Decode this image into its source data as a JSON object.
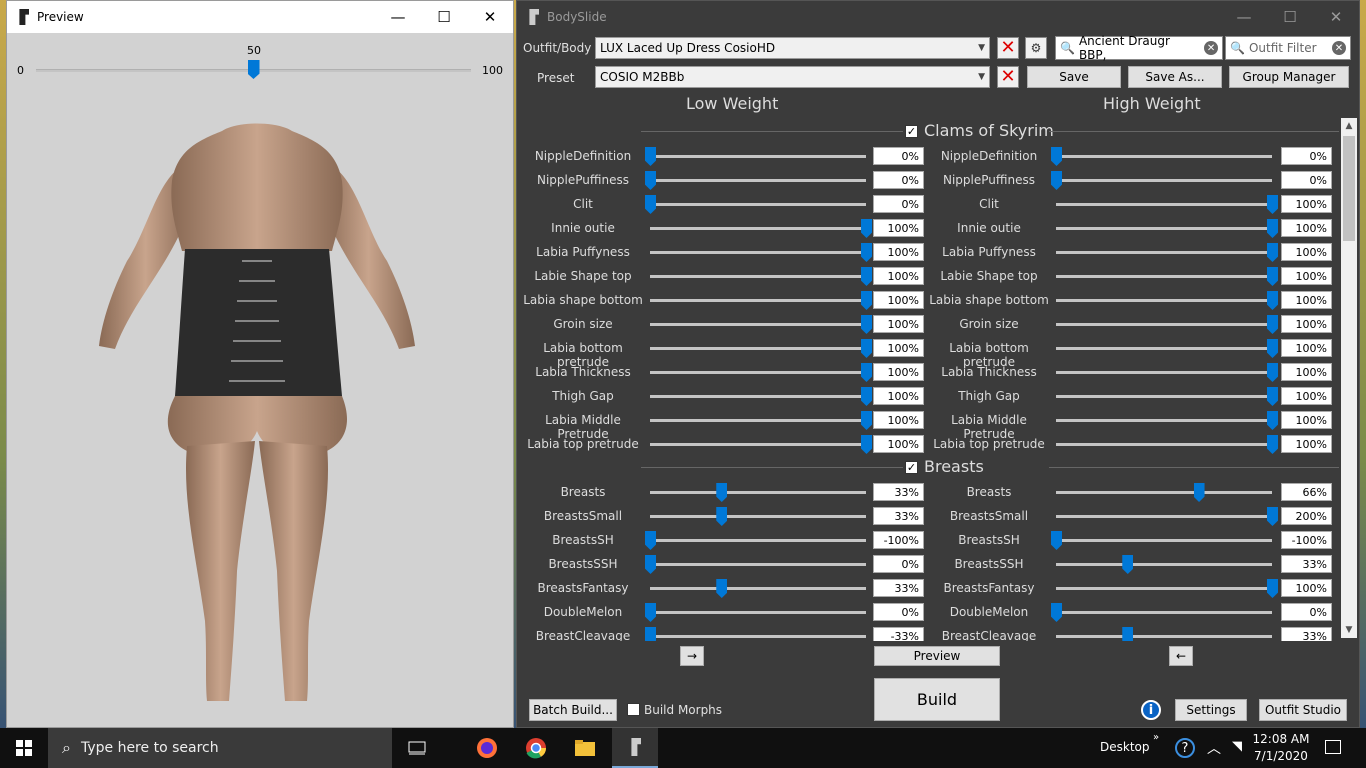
{
  "preview": {
    "title": "Preview",
    "slider_min": "0",
    "slider_max": "100",
    "slider_value": "50",
    "slider_level": 0.5
  },
  "bodyslide": {
    "title": "BodySlide",
    "outfit_label": "Outfit/Body",
    "outfit_value": "LUX Laced Up Dress CosioHD",
    "preset_label": "Preset",
    "preset_value": "COSIO M2BBb",
    "group_filter_value": "Ancient Draugr BBP,",
    "outfit_filter_placeholder": "Outfit Filter",
    "save_label": "Save",
    "save_as_label": "Save As...",
    "group_manager_label": "Group Manager",
    "low_weight_label": "Low Weight",
    "high_weight_label": "High Weight",
    "arrow_right": "→",
    "arrow_left": "←",
    "preview_label": "Preview",
    "build_label": "Build",
    "batch_build_label": "Batch Build...",
    "build_morphs_label": "Build Morphs",
    "settings_label": "Settings",
    "outfit_studio_label": "Outfit Studio",
    "groups": [
      {
        "name": "Clams of Skyrim",
        "sliders": [
          {
            "name": "NippleDefinition",
            "low": "0%",
            "high": "0%",
            "lowv": 0,
            "highv": 0
          },
          {
            "name": "NipplePuffiness",
            "low": "0%",
            "high": "0%",
            "lowv": 0,
            "highv": 0
          },
          {
            "name": "Clit",
            "low": "0%",
            "high": "100%",
            "lowv": 0,
            "highv": 100
          },
          {
            "name": "Innie outie",
            "low": "100%",
            "high": "100%",
            "lowv": 100,
            "highv": 100
          },
          {
            "name": "Labia Puffyness",
            "low": "100%",
            "high": "100%",
            "lowv": 100,
            "highv": 100
          },
          {
            "name": "Labie Shape top",
            "low": "100%",
            "high": "100%",
            "lowv": 100,
            "highv": 100
          },
          {
            "name": "Labia shape bottom",
            "low": "100%",
            "high": "100%",
            "lowv": 100,
            "highv": 100
          },
          {
            "name": "Groin size",
            "low": "100%",
            "high": "100%",
            "lowv": 100,
            "highv": 100
          },
          {
            "name": "Labia bottom pretrude",
            "low": "100%",
            "high": "100%",
            "lowv": 100,
            "highv": 100
          },
          {
            "name": "Labia Thickness",
            "low": "100%",
            "high": "100%",
            "lowv": 100,
            "highv": 100
          },
          {
            "name": "Thigh Gap",
            "low": "100%",
            "high": "100%",
            "lowv": 100,
            "highv": 100
          },
          {
            "name": "Labia Middle Pretrude",
            "low": "100%",
            "high": "100%",
            "lowv": 100,
            "highv": 100
          },
          {
            "name": "Labia top pretrude",
            "low": "100%",
            "high": "100%",
            "lowv": 100,
            "highv": 100
          }
        ]
      },
      {
        "name": "Breasts",
        "sliders": [
          {
            "name": "Breasts",
            "low": "33%",
            "high": "66%",
            "lowv": 33,
            "highv": 66
          },
          {
            "name": "BreastsSmall",
            "low": "33%",
            "high": "200%",
            "lowv": 33,
            "highv": 100
          },
          {
            "name": "BreastsSH",
            "low": "-100%",
            "high": "-100%",
            "lowv": 0,
            "highv": 0
          },
          {
            "name": "BreastsSSH",
            "low": "0%",
            "high": "33%",
            "lowv": 0,
            "highv": 33
          },
          {
            "name": "BreastsFantasy",
            "low": "33%",
            "high": "100%",
            "lowv": 33,
            "highv": 100
          },
          {
            "name": "DoubleMelon",
            "low": "0%",
            "high": "0%",
            "lowv": 0,
            "highv": 0
          },
          {
            "name": "BreastCleavage",
            "low": "-33%",
            "high": "33%",
            "lowv": 0,
            "highv": 33
          }
        ]
      }
    ]
  },
  "taskbar": {
    "search_placeholder": "Type here to search",
    "desktop_label": "Desktop",
    "time": "12:08 AM",
    "date": "7/1/2020"
  }
}
